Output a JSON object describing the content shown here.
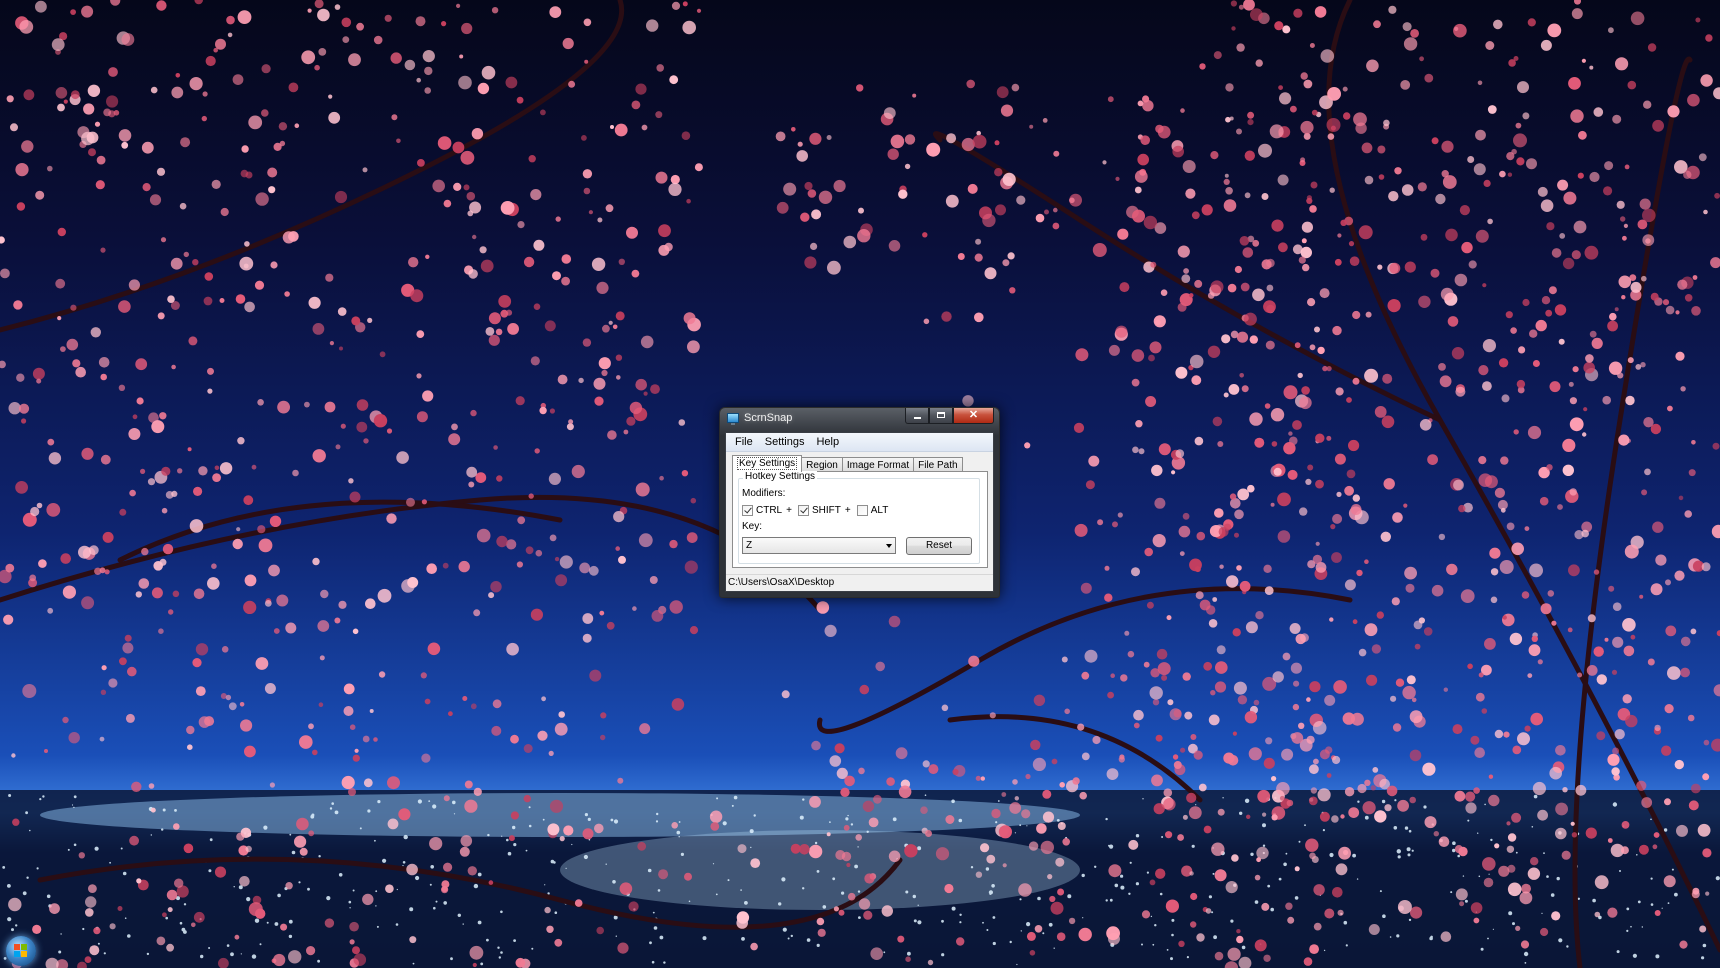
{
  "window": {
    "title": "ScrnSnap"
  },
  "menu": {
    "items": [
      {
        "label": "File"
      },
      {
        "label": "Settings"
      },
      {
        "label": "Help"
      }
    ]
  },
  "tabs": [
    {
      "label": "Key Settings",
      "active": true
    },
    {
      "label": "Region",
      "active": false
    },
    {
      "label": "Image Format",
      "active": false
    },
    {
      "label": "File Path",
      "active": false
    }
  ],
  "hotkey": {
    "group_title": "Hotkey Settings",
    "modifiers_label": "Modifiers:",
    "modifiers": [
      {
        "label": "CTRL",
        "checked": true,
        "plus": "+"
      },
      {
        "label": "SHIFT",
        "checked": true,
        "plus": "+"
      },
      {
        "label": "ALT",
        "checked": false
      }
    ],
    "key_label": "Key:",
    "key_value": "Z",
    "reset_label": "Reset"
  },
  "status": {
    "path": "C:\\Users\\OsaX\\Desktop"
  },
  "icons": {
    "app": "monitor-icon",
    "start": "windows-start-orb-icon"
  },
  "colors": {
    "sky_top": "#05071a",
    "sky_mid": "#0e2470",
    "city_glow": "#3d7fe0",
    "blossom": "#e8607e",
    "close_button": "#c8523d"
  }
}
